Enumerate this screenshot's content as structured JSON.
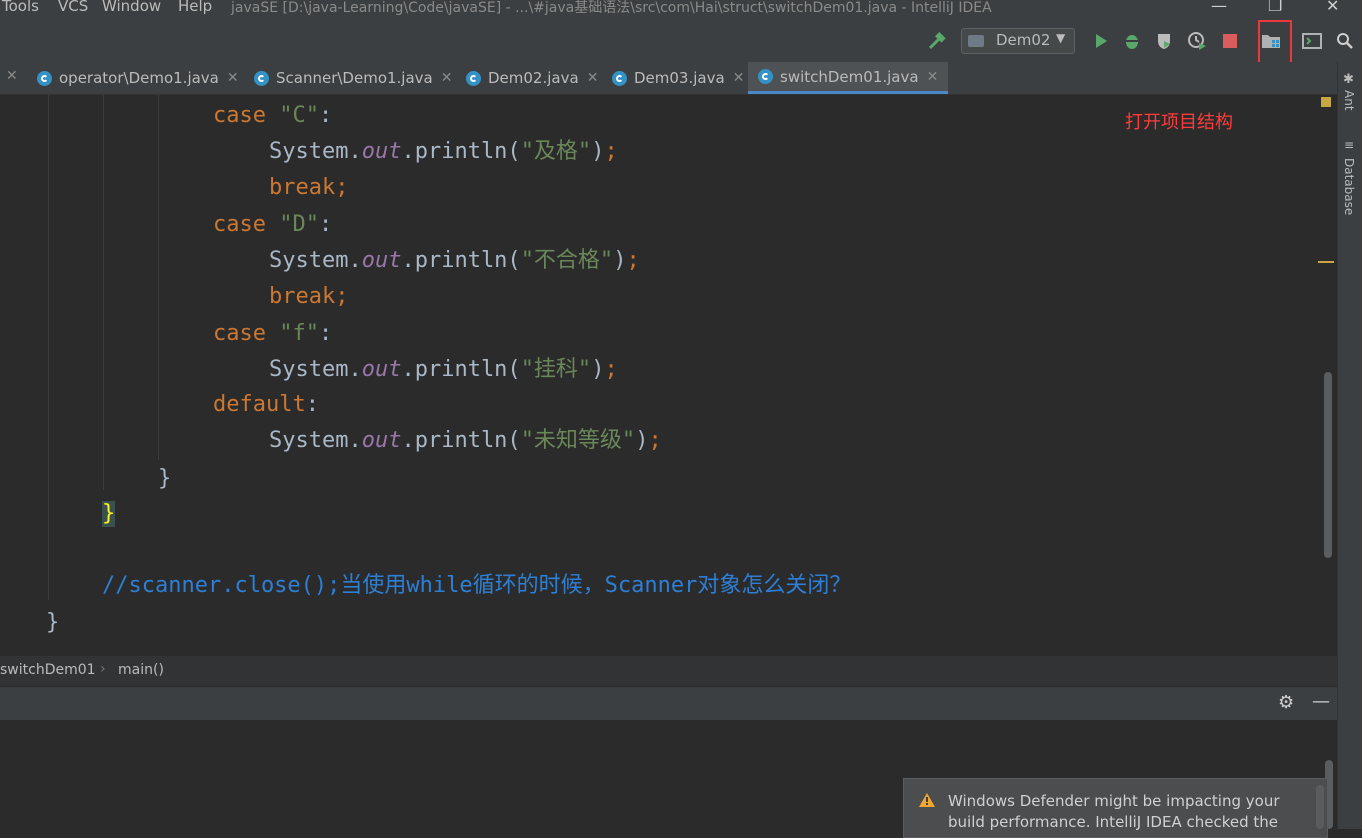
{
  "menu": {
    "items": [
      "Tools",
      "VCS",
      "Window",
      "Help"
    ],
    "title": "javaSE [D:\\java-Learning\\Code\\javaSE] - ...\\#java基础语法\\src\\com\\Hai\\struct\\switchDem01.java - IntelliJ IDEA"
  },
  "toolbar": {
    "run_config": "Dem02"
  },
  "tabs": [
    "operator\\Demo1.java",
    "Scanner\\Demo1.java",
    "Dem02.java",
    "Dem03.java",
    "switchDem01.java"
  ],
  "code": {
    "case_c_kw": "case",
    "case_c_val": "\"C\"",
    "colon": ":",
    "sys1": "System.",
    "out": "out",
    "println": ".println(",
    "str_pass": "\"及格\"",
    "close_paren": ")",
    "semi": ";",
    "break": "break;",
    "case_d_kw": "case",
    "case_d_val": "\"D\"",
    "str_fail": "\"不合格\"",
    "case_f_kw": "case",
    "case_f_val": "\"f\"",
    "str_hang": "\"挂科\"",
    "default_kw": "default",
    "str_unknown": "\"未知等级\"",
    "brace": "}",
    "comment": "//scanner.close();当使用while循环的时候，Scanner对象怎么关闭？"
  },
  "annotation": "打开项目结构",
  "rightbar": {
    "ant": "Ant",
    "database": "Database"
  },
  "breadcrumb": {
    "class": "switchDem01",
    "method": "main()"
  },
  "notification": {
    "line1": "Windows Defender might be impacting your",
    "line2": "build performance. IntelliJ IDEA checked the"
  },
  "colors": {
    "accent": "#4a88c7",
    "highlight": "#e83a3a",
    "keyword": "#cc7832",
    "string": "#6a8759"
  }
}
